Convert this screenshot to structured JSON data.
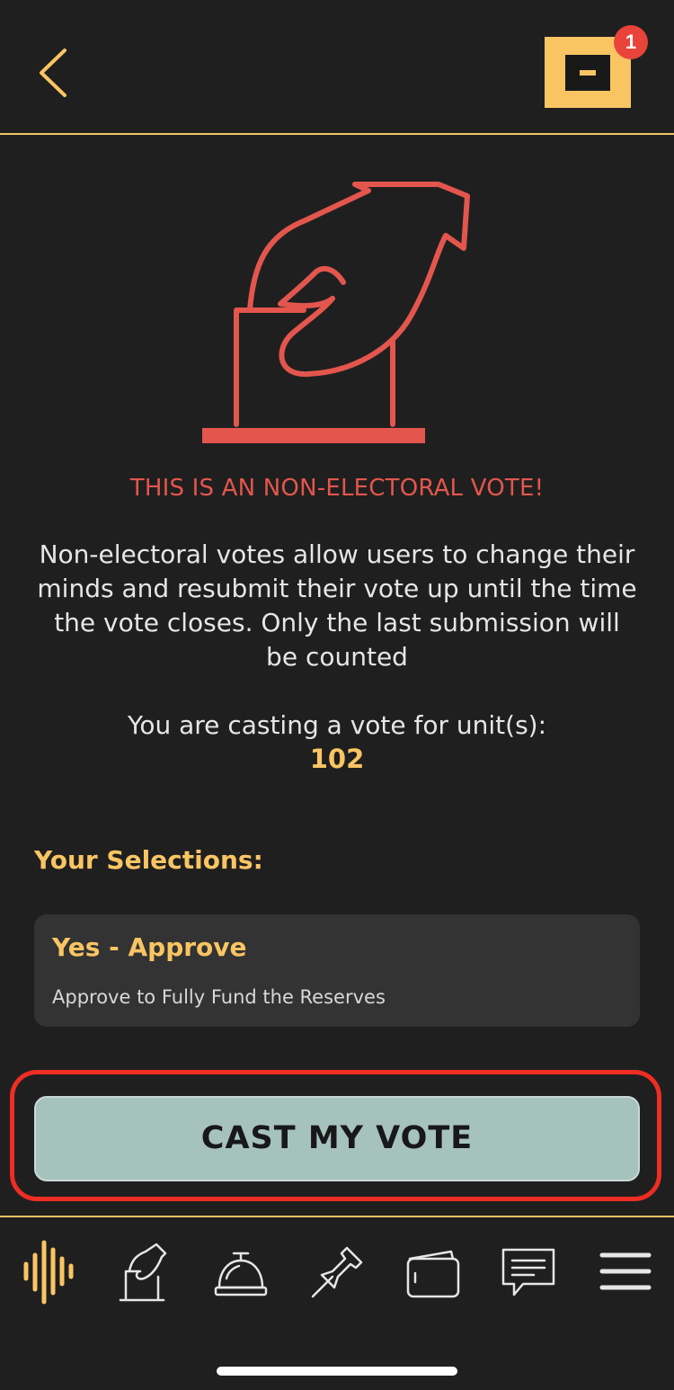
{
  "header": {
    "back_icon": "chevron-left-icon",
    "notification_icon": "ballot-box-icon",
    "notification_count": "1"
  },
  "colors": {
    "background": "#1f1f1f",
    "accent": "#f9c563",
    "alert": "#e3564d",
    "button": "#a6c2bd",
    "highlight": "#ee2d23"
  },
  "vote": {
    "illustration_icon": "hand-casting-ballot-icon",
    "headline": "THIS IS AN NON-ELECTORAL VOTE!",
    "description": "Non-electoral votes allow users to change their minds and resubmit their vote up until the time the vote closes. Only the last submission will be counted",
    "units_caption": "You are casting a vote for unit(s):",
    "units_value": "102"
  },
  "selections": {
    "heading": "Your Selections:",
    "items": [
      {
        "title": "Yes - Approve",
        "description": "Approve to Fully Fund the Reserves"
      }
    ]
  },
  "cast_button": {
    "label": "CAST MY VOTE"
  },
  "tabbar": {
    "items": [
      {
        "icon": "audio-waveform-icon",
        "active": true
      },
      {
        "icon": "vote-icon",
        "active": false
      },
      {
        "icon": "service-bell-icon",
        "active": false
      },
      {
        "icon": "pushpin-icon",
        "active": false
      },
      {
        "icon": "wallet-icon",
        "active": false
      },
      {
        "icon": "message-icon",
        "active": false
      },
      {
        "icon": "hamburger-menu-icon",
        "active": false
      }
    ]
  }
}
